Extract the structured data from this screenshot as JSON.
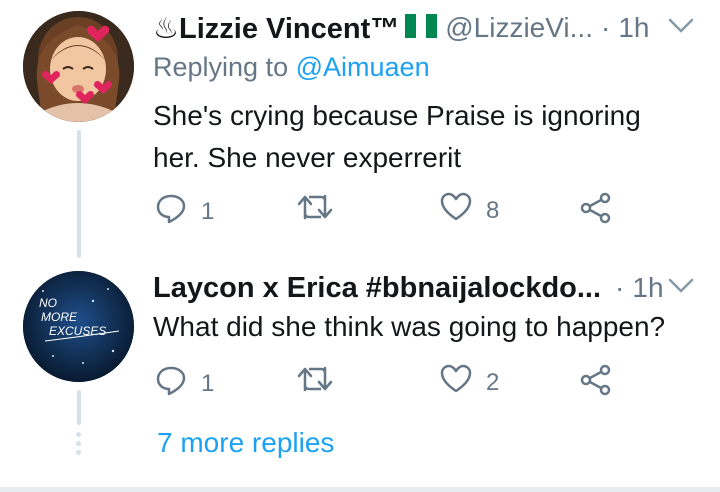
{
  "tweet1": {
    "name": "♨Lizzie Vincent™",
    "flag": "nigeria-flag",
    "handle": "@LizzieVi...",
    "separator": "·",
    "time": "1h",
    "replying_prefix": "Replying to",
    "replying_to": "@Aimuaen",
    "text": "She's crying because Praise is ignoring her. She never experrerit",
    "reply_count": "1",
    "retweet_count": "",
    "like_count": "8"
  },
  "tweet2": {
    "name": "Laycon x Erica #bbnaijalockdo...",
    "separator": "·",
    "time": "1h",
    "text": "What did she think was going to happen?",
    "reply_count": "1",
    "retweet_count": "",
    "like_count": "2",
    "avatar_text": [
      "NO",
      "MORE",
      "EXCUSES"
    ]
  },
  "more_replies": "7 more replies",
  "colors": {
    "text": "#14171a",
    "secondary": "#657786",
    "link": "#1da1f2",
    "thread_line": "#d9e1e8"
  }
}
